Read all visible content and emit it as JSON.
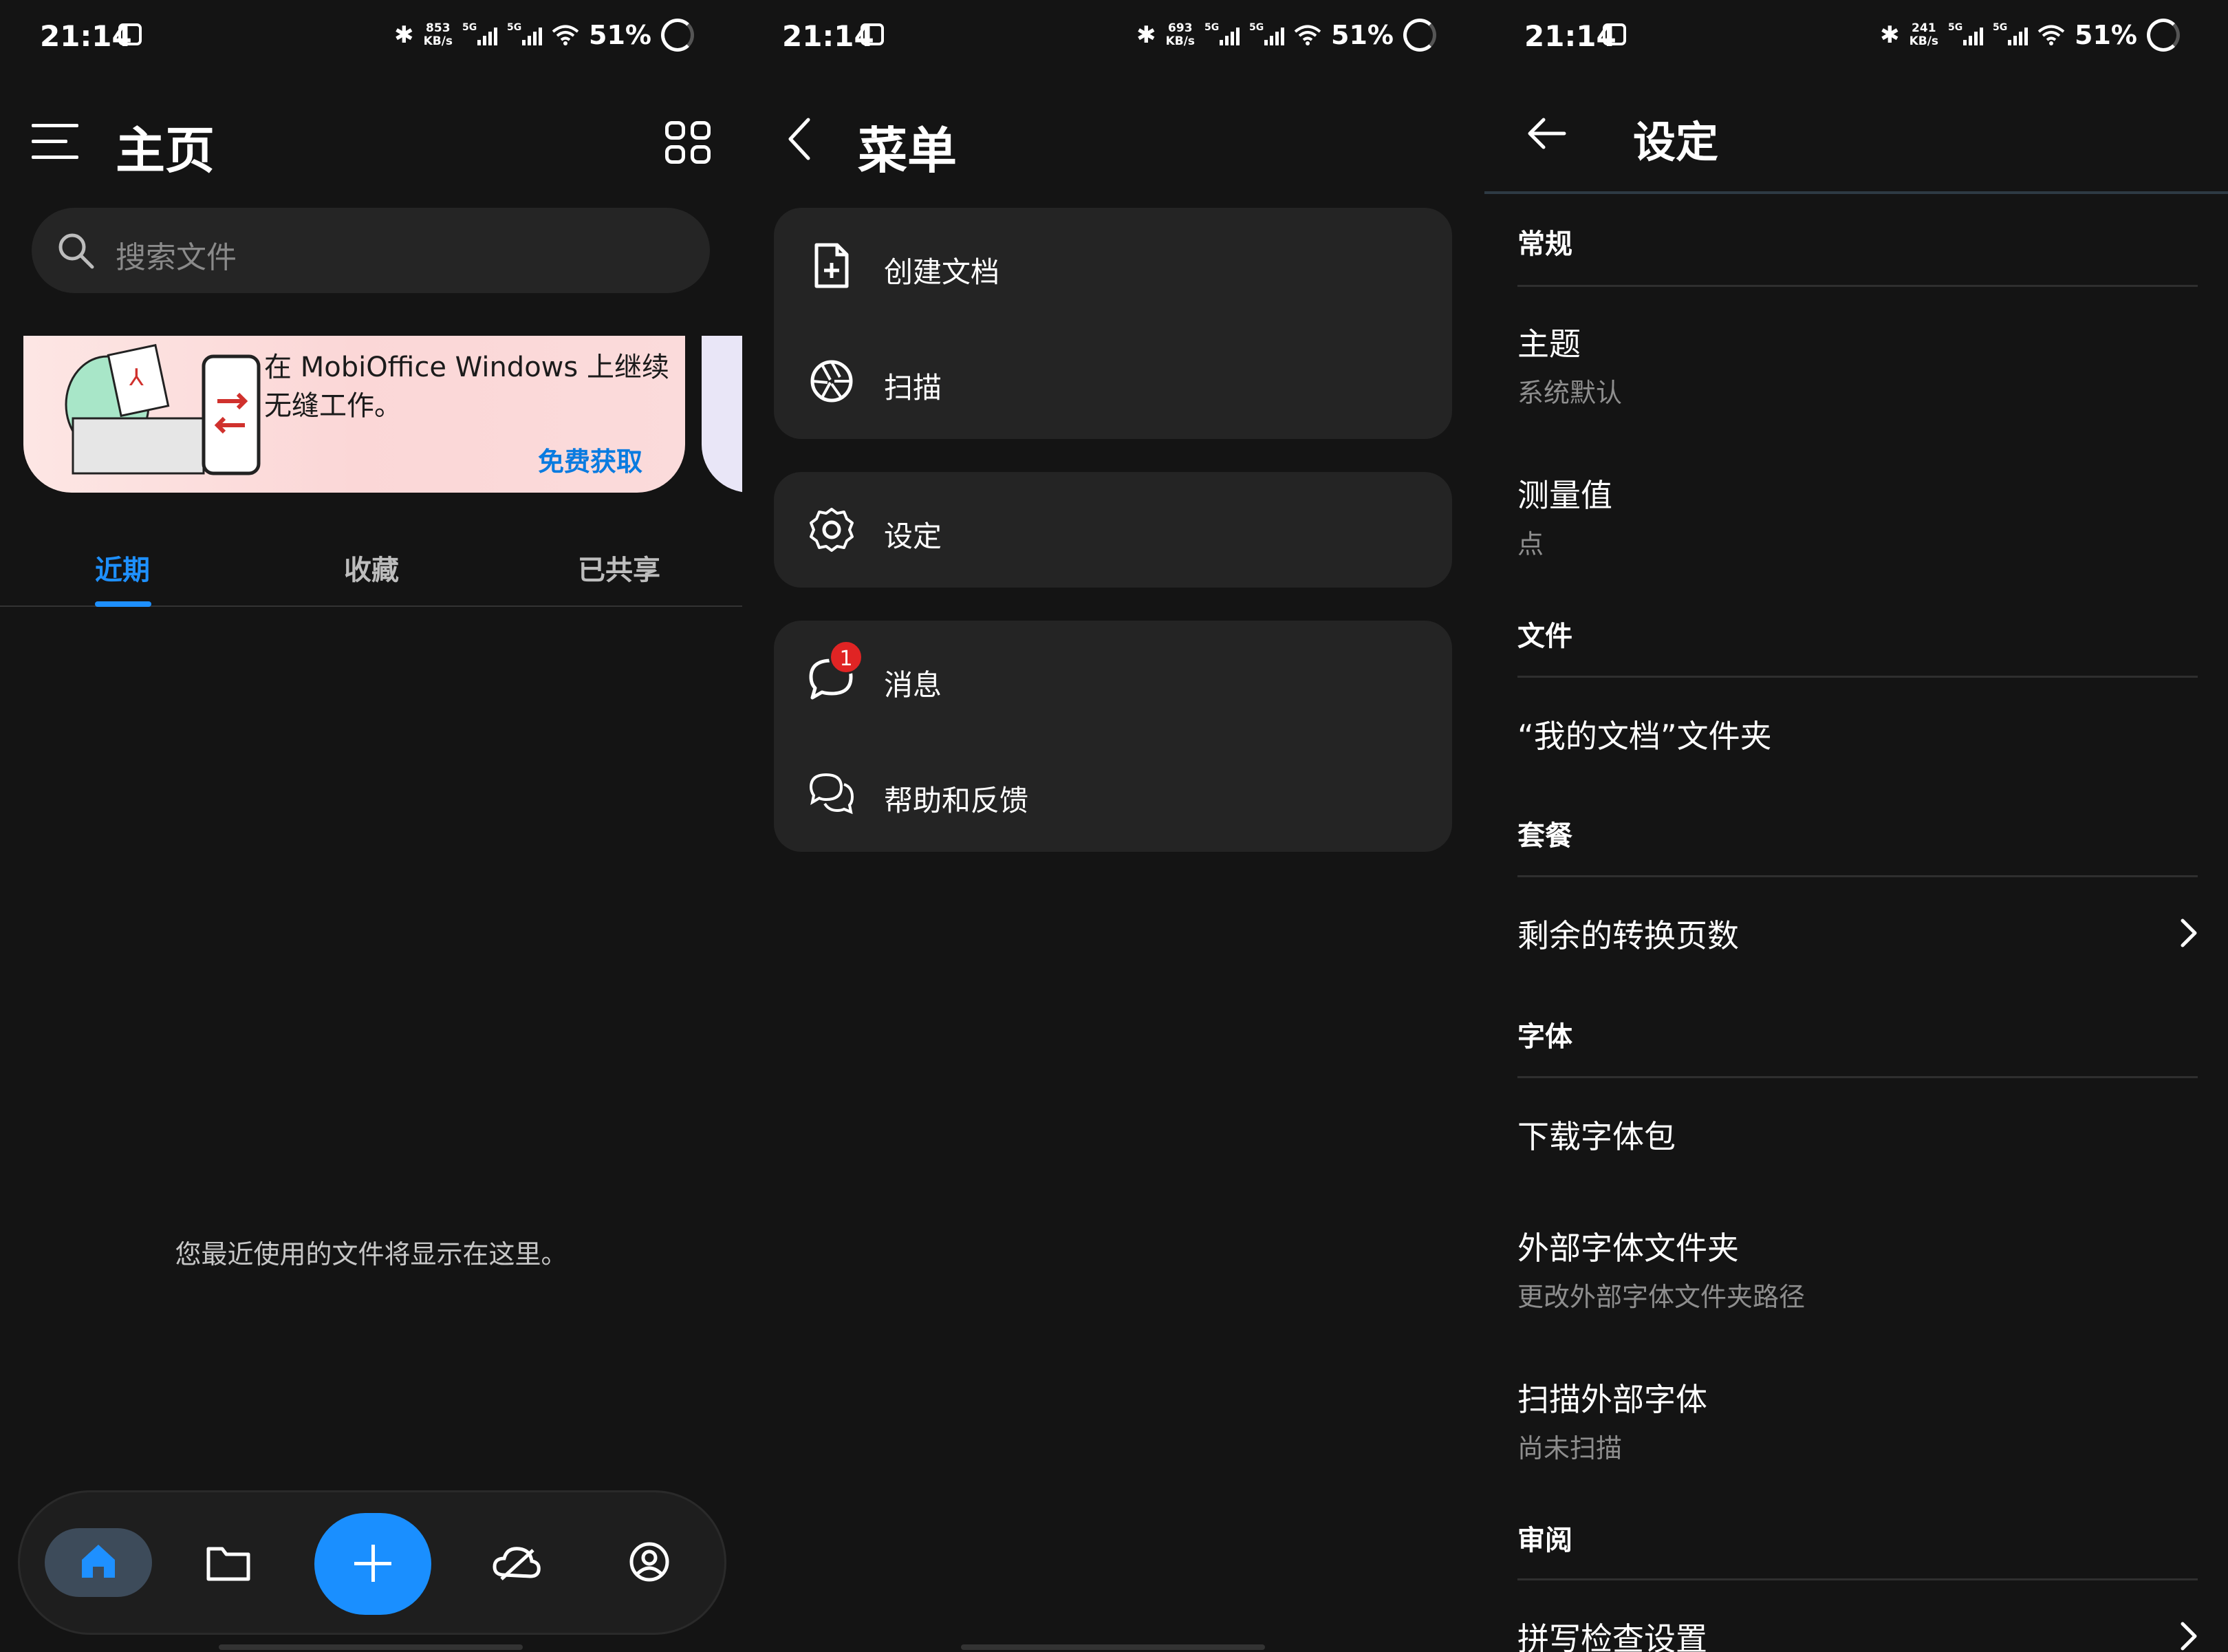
{
  "status_bars": [
    {
      "time": "21:14",
      "speed_top": "853",
      "speed_unit": "KB/s",
      "net1": "5G",
      "net2": "5G",
      "battery": "51%"
    },
    {
      "time": "21:14",
      "speed_top": "693",
      "speed_unit": "KB/s",
      "net1": "5G",
      "net2": "5G",
      "battery": "51%"
    },
    {
      "time": "21:14",
      "speed_top": "241",
      "speed_unit": "KB/s",
      "net1": "5G",
      "net2": "5G",
      "battery": "51%"
    }
  ],
  "home": {
    "title": "主页",
    "search_placeholder": "搜索文件",
    "banner_text": "在 MobiOffice Windows 上继续无缝工作。",
    "banner_cta": "免费获取",
    "tabs": [
      "近期",
      "收藏",
      "已共享"
    ],
    "active_tab": "近期",
    "empty_message": "您最近使用的文件将显示在这里。",
    "accent": "#1e90ff"
  },
  "menu": {
    "title": "菜单",
    "items": [
      {
        "label": "创建文档",
        "icon": "new-document-icon"
      },
      {
        "label": "扫描",
        "icon": "scan-aperture-icon"
      },
      {
        "label": "设定",
        "icon": "gear-icon"
      },
      {
        "label": "消息",
        "icon": "message-icon",
        "badge": "1"
      },
      {
        "label": "帮助和反馈",
        "icon": "chat-bubbles-icon"
      }
    ]
  },
  "settings": {
    "title": "设定",
    "sections": {
      "general": "常规",
      "files": "文件",
      "plan": "套餐",
      "fonts": "字体",
      "review": "审阅"
    },
    "items": {
      "theme_title": "主题",
      "theme_value": "系统默认",
      "units_title": "测量值",
      "units_value": "点",
      "docs_folder": "“我的文档”文件夹",
      "conversions": "剩余的转换页数",
      "download_fonts": "下载字体包",
      "ext_font_folder": "外部字体文件夹",
      "ext_font_folder_sub": "更改外部字体文件夹路径",
      "scan_fonts": "扫描外部字体",
      "scan_fonts_sub": "尚未扫描",
      "spellcheck": "拼写检查设置"
    }
  }
}
